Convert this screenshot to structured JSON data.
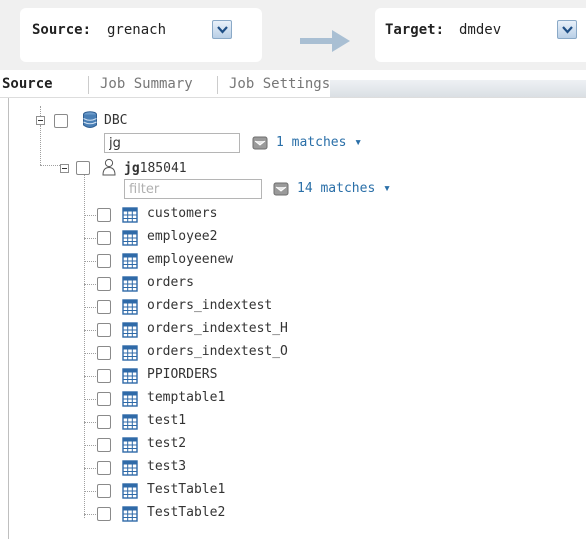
{
  "header": {
    "source_label": "Source:",
    "source_value": "grenach",
    "target_label": "Target:",
    "target_value": "dmdev"
  },
  "tabs": [
    {
      "label": "Source",
      "active": true
    },
    {
      "label": "Job Summary",
      "active": false
    },
    {
      "label": "Job Settings",
      "active": false
    }
  ],
  "tree": {
    "root_label": "DBC",
    "root_filter_value": "jg",
    "root_matches": "1 matches",
    "user_label_bold": "jg",
    "user_label_rest": "185041",
    "user_filter_placeholder": "filter",
    "user_matches": "14 matches",
    "tables": [
      "customers",
      "employee2",
      "employeenew",
      "orders",
      "orders_indextest",
      "orders_indextest_H",
      "orders_indextest_O",
      "PPIORDERS",
      "temptable1",
      "test1",
      "test2",
      "test3",
      "TestTable1",
      "TestTable2"
    ]
  },
  "colors": {
    "accent_link": "#2a6fa8",
    "arrow": "#a9bfd3",
    "db_icon": "#4a7fb5"
  },
  "icons": {
    "arrow": "right-arrow-icon",
    "dropdown": "chevron-down-icon",
    "database": "database-icon",
    "user": "user-icon",
    "table": "table-icon",
    "matches": "filter-results-icon"
  }
}
